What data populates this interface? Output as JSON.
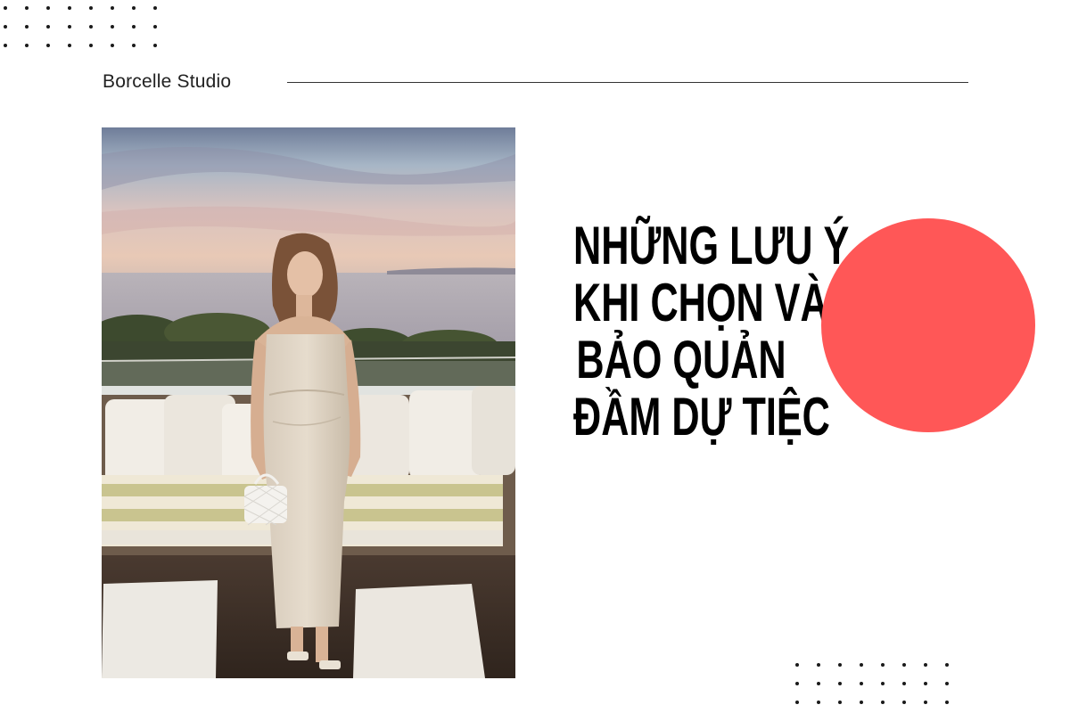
{
  "brand": {
    "name": "Borcelle Studio"
  },
  "headline": {
    "lines": [
      "NHỮNG LƯU Ý",
      "KHI CHỌN VÀ",
      "BẢO QUẢN",
      "ĐẦM DỰ TIỆC"
    ]
  },
  "colors": {
    "accent": "#ff5757",
    "text": "#000000",
    "background": "#ffffff"
  },
  "photo": {
    "subject": "woman in strapless beige maxi dress holding a white quilted handbag on a seaside terrace at sunset"
  }
}
